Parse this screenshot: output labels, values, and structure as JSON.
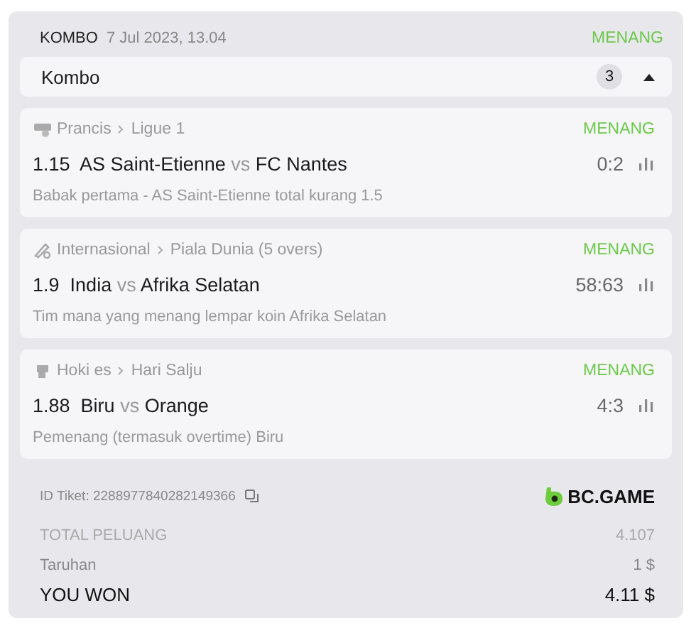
{
  "header": {
    "type": "KOMBO",
    "date": "7 Jul 2023, 13.04",
    "status": "MENANG"
  },
  "group": {
    "title": "Kombo",
    "count": "3",
    "expanded": true
  },
  "bets": [
    {
      "kind": "soccer",
      "country": "Prancis",
      "league": "Ligue 1",
      "status": "MENANG",
      "odds": "1.15",
      "home": "AS Saint-Etienne",
      "vs": "vs",
      "away": "FC Nantes",
      "score": "0:2",
      "market": "Babak pertama - AS Saint-Etienne total kurang 1.5"
    },
    {
      "kind": "cricket",
      "country": "Internasional",
      "league": "Piala Dunia (5 overs)",
      "status": "MENANG",
      "odds": "1.9",
      "home": "India",
      "vs": "vs",
      "away": "Afrika Selatan",
      "score": "58:63",
      "market": "Tim mana yang menang lempar koin Afrika Selatan"
    },
    {
      "kind": "hockey",
      "country": "Hoki es",
      "league": "Hari Salju",
      "status": "MENANG",
      "odds": "1.88",
      "home": "Biru",
      "vs": "vs",
      "away": "Orange",
      "score": "4:3",
      "market": "Pemenang (termasuk overtime) Biru"
    }
  ],
  "ticket": {
    "label": "ID Tiket: 2288977840282149366",
    "brand": "BC.GAME"
  },
  "summary": [
    {
      "kind": "muted",
      "label": "TOTAL PELUANG",
      "value": "4.107"
    },
    {
      "kind": "normal",
      "label": "Taruhan",
      "value": "1 $"
    },
    {
      "kind": "total",
      "label": "YOU WON",
      "value": "4.11 $"
    }
  ]
}
